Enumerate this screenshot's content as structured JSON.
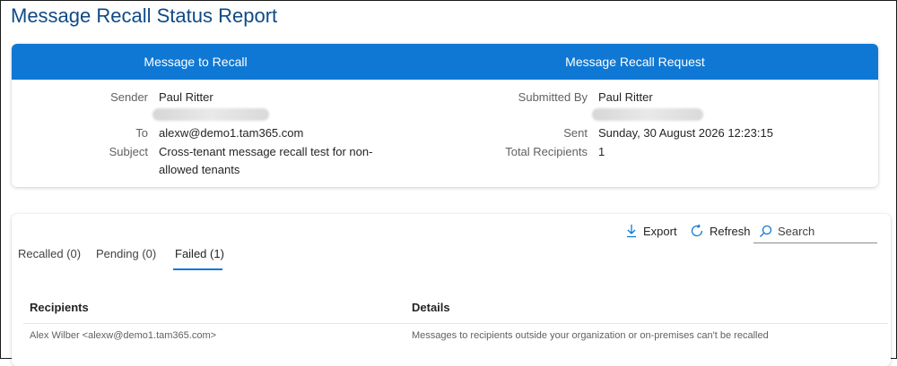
{
  "page": {
    "title": "Message Recall Status Report"
  },
  "message_card": {
    "left_header": "Message to Recall",
    "right_header": "Message Recall Request",
    "left": {
      "sender_label": "Sender",
      "sender_value": "Paul Ritter",
      "to_label": "To",
      "to_value": "alexw@demo1.tam365.com",
      "subject_label": "Subject",
      "subject_line1": "Cross-tenant message recall test for non-",
      "subject_line2": "allowed tenants"
    },
    "right": {
      "submitted_by_label": "Submitted By",
      "submitted_by_value": "Paul Ritter",
      "sent_label": "Sent",
      "sent_value": "Sunday, 30 August 2026 12:23:15",
      "total_recipients_label": "Total Recipients",
      "total_recipients_value": "1"
    }
  },
  "results_card": {
    "toolbar": {
      "export_label": "Export",
      "refresh_label": "Refresh",
      "search_placeholder": "Search"
    },
    "tabs": [
      {
        "label": "Recalled (0)"
      },
      {
        "label": "Pending (0)"
      },
      {
        "label": "Failed (1)",
        "active": true
      }
    ],
    "table": {
      "columns": [
        "Recipients",
        "Details"
      ],
      "rows": [
        {
          "recipient": "Alex Wilber <alexw@demo1.tam365.com>",
          "details": "Messages to recipients outside your organization or on-premises can't be recalled"
        }
      ]
    }
  },
  "colors": {
    "accent": "#0f78d4",
    "title": "#0f4a85"
  }
}
